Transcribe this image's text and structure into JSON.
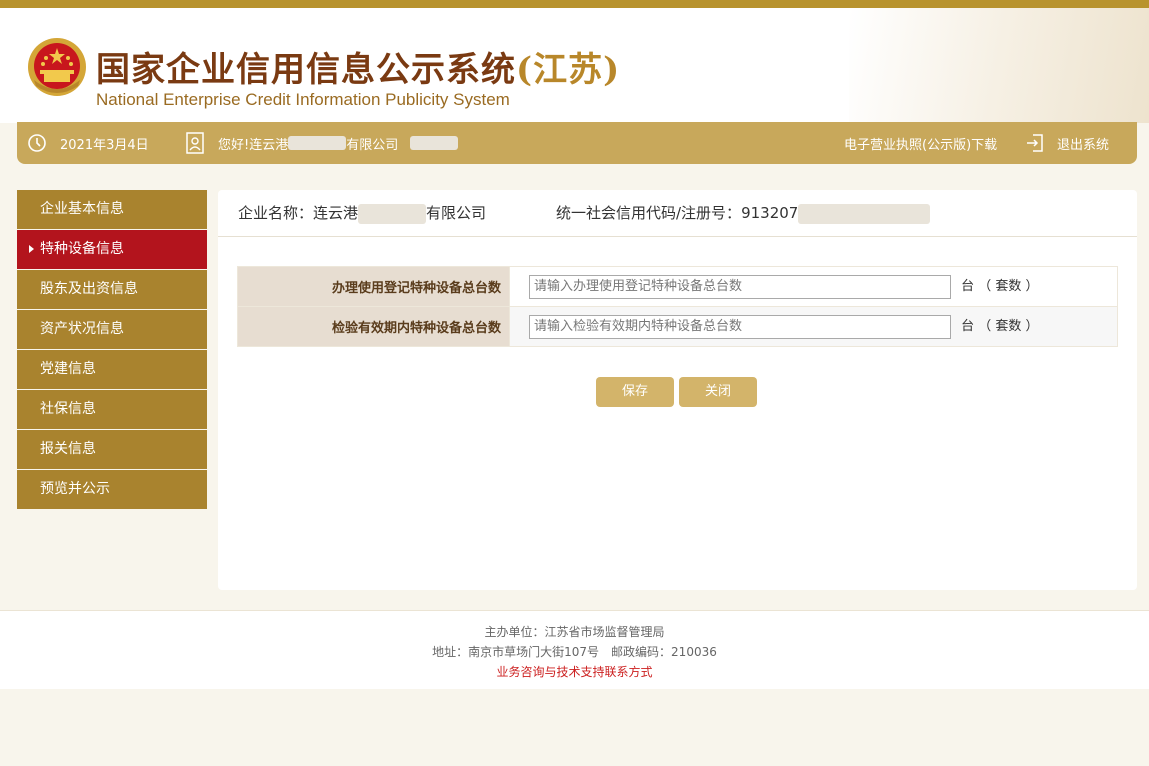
{
  "header": {
    "title_main": "国家企业信用信息公示系统",
    "title_region": "(江苏)",
    "subtitle": "National Enterprise Credit Information Publicity System"
  },
  "infobar": {
    "date": "2021年3月4日",
    "greeting_prefix": "您好!连云港",
    "greeting_suffix": "有限公司",
    "license_download": "电子营业执照(公示版)下载",
    "logout": "退出系统"
  },
  "sidebar": {
    "items": [
      {
        "label": "企业基本信息",
        "active": false
      },
      {
        "label": "特种设备信息",
        "active": true
      },
      {
        "label": "股东及出资信息",
        "active": false
      },
      {
        "label": "资产状况信息",
        "active": false
      },
      {
        "label": "党建信息",
        "active": false
      },
      {
        "label": "社保信息",
        "active": false
      },
      {
        "label": "报关信息",
        "active": false
      },
      {
        "label": "预览并公示",
        "active": false
      }
    ]
  },
  "main": {
    "company_label": "企业名称：",
    "company_prefix": "连云港",
    "company_suffix": "有限公司",
    "credit_code_label": "统一社会信用代码/注册号：",
    "credit_code_prefix": "913207",
    "form": {
      "rows": [
        {
          "label": "办理使用登记特种设备总台数",
          "placeholder": "请输入办理使用登记特种设备总台数",
          "value": "",
          "unit": "台 （ 套数 ）"
        },
        {
          "label": "检验有效期内特种设备总台数",
          "placeholder": "请输入检验有效期内特种设备总台数",
          "value": "",
          "unit": "台 （ 套数 ）"
        }
      ]
    },
    "buttons": {
      "save": "保存",
      "close": "关闭"
    }
  },
  "footer": {
    "sponsor": "主办单位：江苏省市场监督管理局",
    "address": "地址：南京市草场门大街107号",
    "postcode": "邮政编码：210036",
    "support_link": "业务咨询与技术支持联系方式"
  },
  "colors": {
    "gold": "#c8a85b",
    "nav": "#a9832e",
    "active": "#b3141d",
    "button": "#d3b46a"
  }
}
